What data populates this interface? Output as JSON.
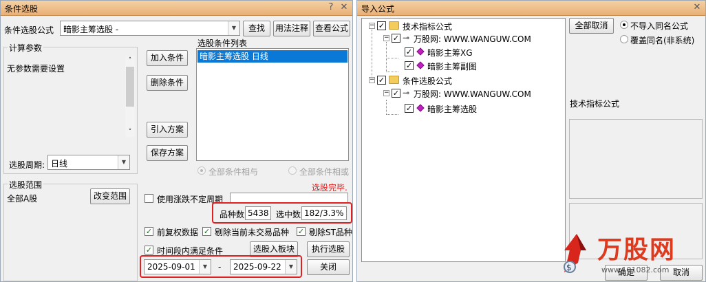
{
  "left": {
    "title": "条件选股",
    "formula_label": "条件选股公式",
    "formula_value": "暗影主筹选股  -",
    "btn_find": "查找",
    "btn_usage": "用法注释",
    "btn_view": "查看公式",
    "calc_group": "计算参数",
    "calc_text": "无参数需要设置",
    "period_label": "选股周期:",
    "period_value": "日线",
    "btn_add": "加入条件",
    "btn_delete": "删除条件",
    "btn_import": "引入方案",
    "btn_save": "保存方案",
    "cond_list_label": "选股条件列表",
    "cond_item": "暗影主筹选股  日线",
    "radio_and": "全部条件相与",
    "radio_or": "全部条件相或",
    "status": "选股完毕.",
    "range_group": "选股范围",
    "range_value": "全部A股",
    "btn_change_range": "改变范围",
    "use_period_label": "使用涨跌不定周期",
    "count_label": "品种数",
    "count_value": "5438",
    "selected_label": "选中数",
    "selected_value": "182/3.3%",
    "chk_fq": "前复权数据",
    "chk_remove_untraded": "剔除当前未交易品种",
    "chk_remove_st": "剔除ST品种",
    "chk_time_range": "时间段内满足条件",
    "btn_to_block": "选股入板块",
    "btn_run": "执行选股",
    "date_from": "2025-09-01",
    "date_sep": "-",
    "date_to": "2025-09-22",
    "btn_close": "关闭"
  },
  "right": {
    "title": "导入公式",
    "tree": [
      {
        "label": "技术指标公式",
        "kind": "folder"
      },
      {
        "label": "万股网: WWW.WANGUW.COM",
        "kind": "key"
      },
      {
        "label": "暗影主筹XG",
        "kind": "formula"
      },
      {
        "label": "暗影主筹副图",
        "kind": "formula"
      },
      {
        "label": "条件选股公式",
        "kind": "folder"
      },
      {
        "label": "万股网: WWW.WANGUW.COM",
        "kind": "key"
      },
      {
        "label": "暗影主筹选股",
        "kind": "formula"
      }
    ],
    "btn_cancel_all": "全部取消",
    "radio_no_import": "不导入同名公式",
    "radio_overwrite": "覆盖同名(非系统)",
    "type_label": "技术指标公式",
    "btn_ok": "确定",
    "btn_cancel": "取消"
  },
  "watermark": {
    "brand": "万股网",
    "site": "www.101082.com"
  }
}
